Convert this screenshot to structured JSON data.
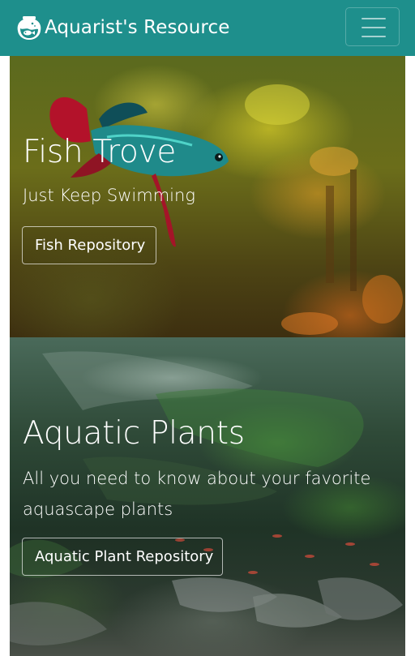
{
  "navbar": {
    "brand_text": "Aquarist's Resource",
    "brand_icon": "fishbowl-icon",
    "toggler_icon": "hamburger-menu-icon",
    "background_color": "#1e8f8c"
  },
  "hero_fish": {
    "title": "Fish Trove",
    "subtitle": "Just Keep Swimming",
    "button_label": "Fish Repository"
  },
  "hero_plants": {
    "title": "Aquatic Plants",
    "subtitle": "All you need to know about your favorite aquascape plants",
    "button_label": "Aquatic Plant Repository"
  }
}
